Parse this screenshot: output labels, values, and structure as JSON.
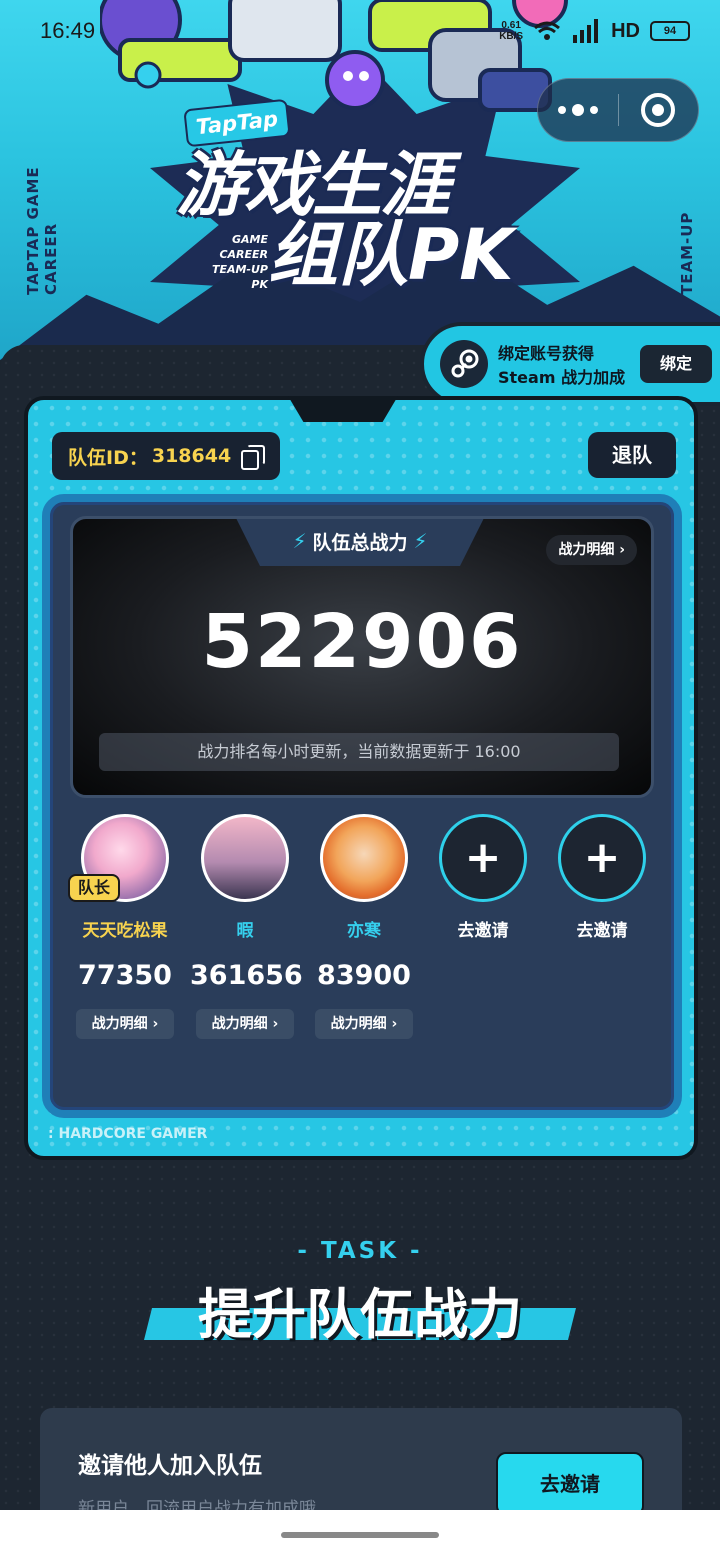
{
  "status_bar": {
    "time": "16:49",
    "net_speed": "0.61",
    "net_unit": "KB/S",
    "network": "4G",
    "hd": "HD",
    "battery": "94"
  },
  "hero": {
    "brand": "TapTap",
    "title_line1": "游戏生涯",
    "title_line2": "组队PK",
    "subtitle": "GAME CAREER TEAM-UP PK",
    "side_left": "TAPTAP GAME CAREER",
    "side_right": "TEAM-UP"
  },
  "steam": {
    "line1": "绑定账号获得",
    "line2": "Steam 战力加成",
    "bind_label": "绑定"
  },
  "team": {
    "id_label": "队伍ID：",
    "id_value": "318644",
    "quit_label": "退队",
    "total_label": "队伍总战力",
    "detail_label": "战力明细",
    "total_power": "522906",
    "update_note": "战力排名每小时更新，当前数据更新于 16:00",
    "footer_tag": ": HARDCORE GAMER"
  },
  "members": [
    {
      "name": "天天吃松果",
      "power": "77350",
      "detail": "战力明细",
      "badge": "队长"
    },
    {
      "name": "暇",
      "power": "361656",
      "detail": "战力明细"
    },
    {
      "name": "亦寒",
      "power": "83900",
      "detail": "战力明细"
    },
    {
      "name": "去邀请"
    },
    {
      "name": "去邀请"
    }
  ],
  "task": {
    "tag": "- TASK -",
    "title": "提升队伍战力",
    "card_title": "邀请他人加入队伍",
    "card_desc": "新用户、回流用户战力有加成哦",
    "card_button": "去邀请"
  },
  "colors": {
    "accent": "#27c6e4",
    "gold": "#f7d34f",
    "dark": "#1d2631"
  }
}
